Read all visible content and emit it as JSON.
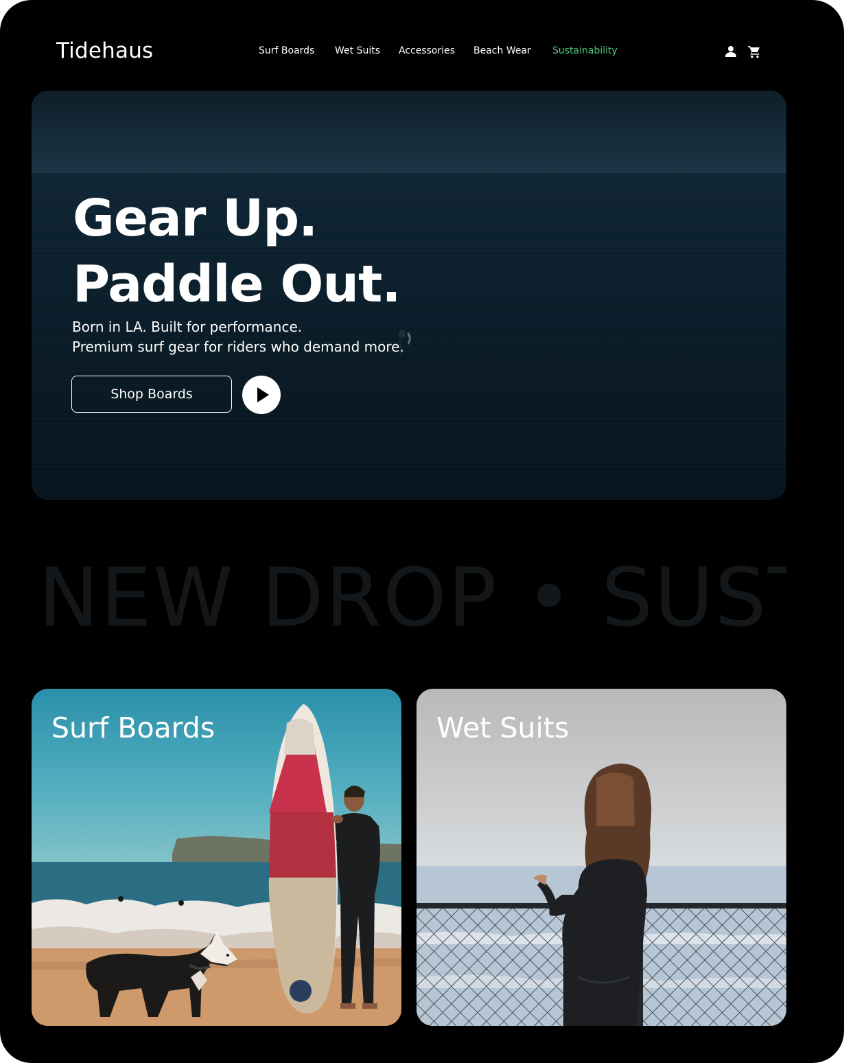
{
  "header": {
    "logo": "Tidehaus",
    "nav": [
      {
        "label": "Surf Boards"
      },
      {
        "label": "Wet Suits"
      },
      {
        "label": "Accessories"
      },
      {
        "label": "Beach Wear"
      },
      {
        "label": "Sustainability"
      }
    ],
    "active_nav": "Sustainability",
    "icons": [
      "user-icon",
      "cart-icon"
    ],
    "accent_color": "#4ec27a"
  },
  "hero": {
    "title_line1": "Gear Up.",
    "title_line2": "Paddle Out.",
    "subtitle_line1": "Born in LA. Built for performance.",
    "subtitle_line2": "Premium surf gear for riders who demand more.",
    "cta_label": "Shop Boards",
    "play_icon": "play-icon"
  },
  "marquee": {
    "text": "NEW DROP • SUSTAINABLE"
  },
  "categories": [
    {
      "title": "Surf Boards"
    },
    {
      "title": "Wet Suits"
    }
  ]
}
